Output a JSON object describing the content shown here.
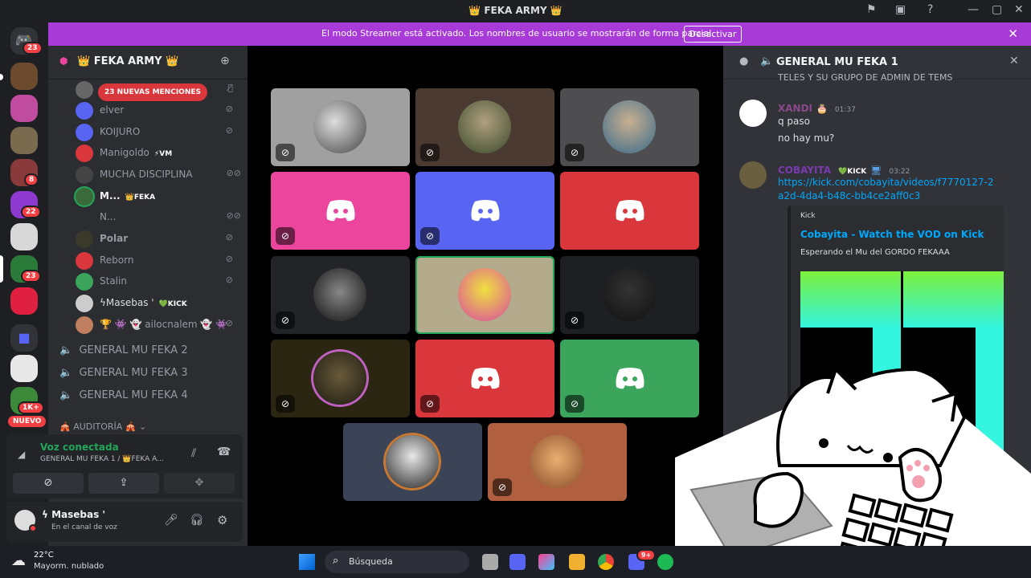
{
  "window": {
    "title": "👑 FEKA ARMY 👑",
    "icons": [
      "inbox-icon",
      "window-icon",
      "help-icon",
      "minimize-icon",
      "maximize-icon",
      "close-icon"
    ]
  },
  "banner": {
    "text": "El modo Streamer está activado. Los nombres de usuario se mostrarán de forma parcial.",
    "button": "Desactivar",
    "close": "✕"
  },
  "rail": {
    "badges": [
      "23",
      "8",
      "22",
      "23",
      "1K+"
    ],
    "new_label": "NUEVO"
  },
  "sidebar": {
    "server_name": "👑 FEKA ARMY 👑",
    "mentions_pill": "23 NUEVAS MENCIONES",
    "voice_users": [
      {
        "name": "",
        "tag": ""
      },
      {
        "name": "elver",
        "tag": ""
      },
      {
        "name": "KOIJURO",
        "tag": ""
      },
      {
        "name": "Manigoldo",
        "tag": "⚡VM"
      },
      {
        "name": "MUCHA DISCIPLINA",
        "tag": ""
      },
      {
        "name": "M...",
        "tag": "👑FEKA"
      },
      {
        "name": "N...",
        "tag": ""
      },
      {
        "name": "Polar",
        "tag": ""
      },
      {
        "name": "Reborn",
        "tag": ""
      },
      {
        "name": "Stalin",
        "tag": ""
      },
      {
        "name": "ϟMasebas '",
        "tag": "💚KICK"
      },
      {
        "name": "🏆 👾 👻 ailocnalem 👻 👾",
        "tag": ""
      }
    ],
    "voice_channels": [
      "GENERAL MU FEKA 2",
      "GENERAL MU FEKA 3",
      "GENERAL MU FEKA 4"
    ],
    "category": "🎪 AUDITORÍA 🎪"
  },
  "voice_panel": {
    "status": "Voz conectada",
    "channel": "GENERAL MU FEKA 1 / 👑FEKA A..."
  },
  "user_panel": {
    "username": "ϟ Masebas '",
    "status": "En el canal de voz"
  },
  "chat": {
    "channel": "GENERAL MU FEKA 1",
    "partial_line": "TELES Y SU GRUPO DE ADMIN DE TEMS",
    "messages": [
      {
        "author": "XANDI",
        "time": "01:37",
        "lines": [
          "q paso",
          "no hay mu?"
        ]
      },
      {
        "author": "COBAYITA",
        "tag": "💚KICK",
        "time": "03:22",
        "link": "https://kick.com/cobayita/videos/f7770127-2a2d-4da4-b48c-bb4ce2aff0c3"
      }
    ],
    "embed": {
      "provider": "Kick",
      "title": "Cobayita - Watch the VOD on Kick",
      "description": "Esperando el Mu del GORDO FEKAAA"
    }
  },
  "taskbar": {
    "weather_temp": "22°C",
    "weather_desc": "Mayorm. nublado",
    "search": "Búsqueda",
    "discord_badge": "9+"
  },
  "colors": {
    "accent": "#a83bd8",
    "pink": "#eb459e",
    "blurple": "#5865f2",
    "red": "#da373c",
    "green": "#3ba55c",
    "link": "#00a8fc",
    "online_green": "#23a55a"
  }
}
